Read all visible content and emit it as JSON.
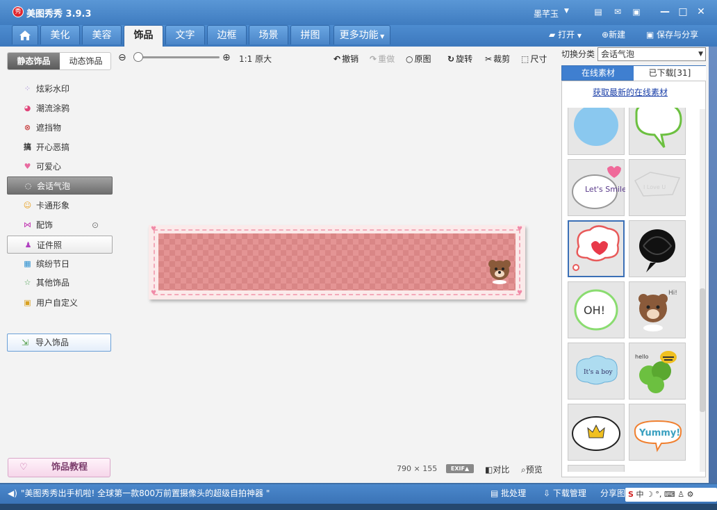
{
  "app": {
    "title": "美图秀秀 3.9.3",
    "logo": "秀",
    "user": "墨芊玉"
  },
  "nav": {
    "tabs": [
      "美化",
      "美容",
      "饰品",
      "文字",
      "边框",
      "场景",
      "拼图",
      "更多功能"
    ],
    "active": "饰品",
    "open": "打开",
    "new": "新建",
    "save_share": "保存与分享"
  },
  "left": {
    "seg_static": "静态饰品",
    "seg_dynamic": "动态饰品",
    "categories": [
      "炫彩水印",
      "潮流涂鸦",
      "遮挡物",
      "开心恶搞",
      "可爱心",
      "会话气泡",
      "卡通形象",
      "配饰",
      "证件照",
      "缤纷节日",
      "其他饰品",
      "用户自定义"
    ],
    "selected": "会话气泡",
    "import": "导入饰品",
    "tutorial": "饰品教程"
  },
  "toolbar": {
    "original_size": "1:1 原大",
    "undo": "撤销",
    "redo": "重做",
    "original": "原图",
    "rotate": "旋转",
    "crop": "裁剪",
    "resize": "尺寸"
  },
  "canvas": {
    "width_text": "790",
    "times": "×",
    "height_text": "155",
    "exif": "EXIF",
    "compare": "对比",
    "preview": "预览"
  },
  "right": {
    "switch_label": "切换分类",
    "select_value": "会话气泡",
    "tab_online": "在线素材",
    "tab_downloaded": "已下载[31]",
    "fetch_link": "获取最新的在线素材",
    "sticker_texts": [
      "Let's Smile",
      "I Love U",
      "OH!",
      "Hi!",
      "It's a boy",
      "hello",
      "Yummy!"
    ]
  },
  "status": {
    "news": "\"美图秀秀出手机啦! 全球第一款800万前置摄像头的超级自拍神器 \"",
    "batch": "批处理",
    "download_mgr": "下载管理",
    "share_img": "分享图片",
    "ime": "中"
  }
}
